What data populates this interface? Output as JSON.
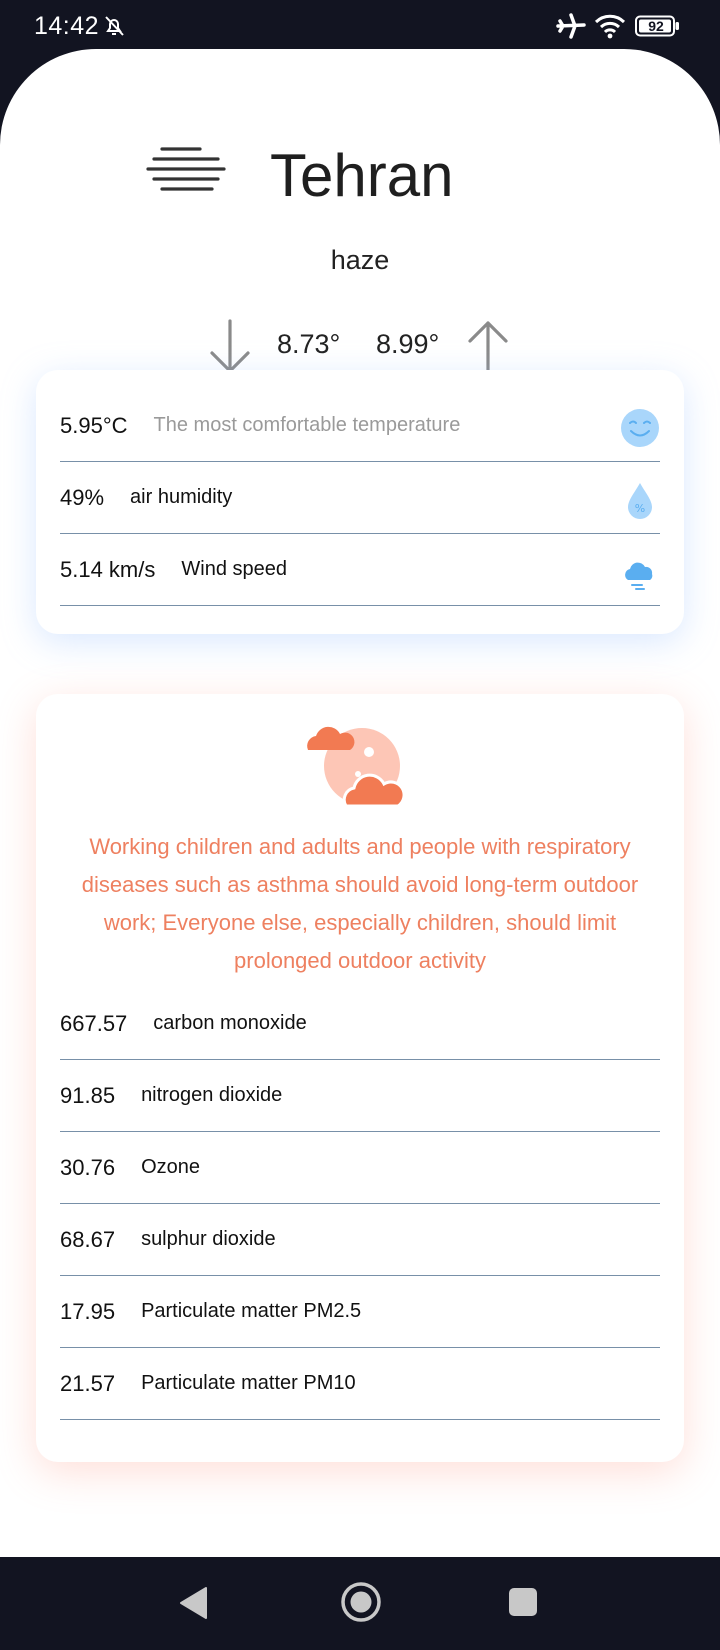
{
  "status_bar": {
    "time": "14:42",
    "battery": "92",
    "icons": [
      "bell-off-icon",
      "airplane-icon",
      "wifi-icon",
      "battery-icon"
    ]
  },
  "header": {
    "menu_icon": "menu-lines-icon",
    "city": "Tehran",
    "condition": "haze",
    "temp_min": "8.73°",
    "temp_max": "8.99°"
  },
  "weather_details": [
    {
      "value": "5.95°C",
      "label": "The most comfortable temperature",
      "icon": "smile-icon"
    },
    {
      "value": "49%",
      "label": "air humidity",
      "icon": "humidity-drop-icon"
    },
    {
      "value": "5.14 km/s",
      "label": "Wind speed",
      "icon": "cloud-wind-icon"
    }
  ],
  "air_quality": {
    "icon": "haze-cloud-icon",
    "advice": "Working children and adults and people with respiratory diseases such as asthma should avoid long-term outdoor work; Everyone else, especially children, should limit prolonged outdoor activity",
    "pollutants": [
      {
        "value": "667.57",
        "label": "carbon monoxide"
      },
      {
        "value": "91.85",
        "label": "nitrogen dioxide"
      },
      {
        "value": "30.76",
        "label": "Ozone"
      },
      {
        "value": "68.67",
        "label": "sulphur dioxide"
      },
      {
        "value": "17.95",
        "label": "Particulate matter PM2.5"
      },
      {
        "value": "21.57",
        "label": "Particulate matter PM10"
      }
    ]
  },
  "colors": {
    "advice": "#ee8060",
    "accent_blue": "#5aaef0",
    "divider": "#7890a8"
  },
  "nav": {
    "icons": [
      "back-icon",
      "home-icon",
      "recents-icon"
    ]
  }
}
